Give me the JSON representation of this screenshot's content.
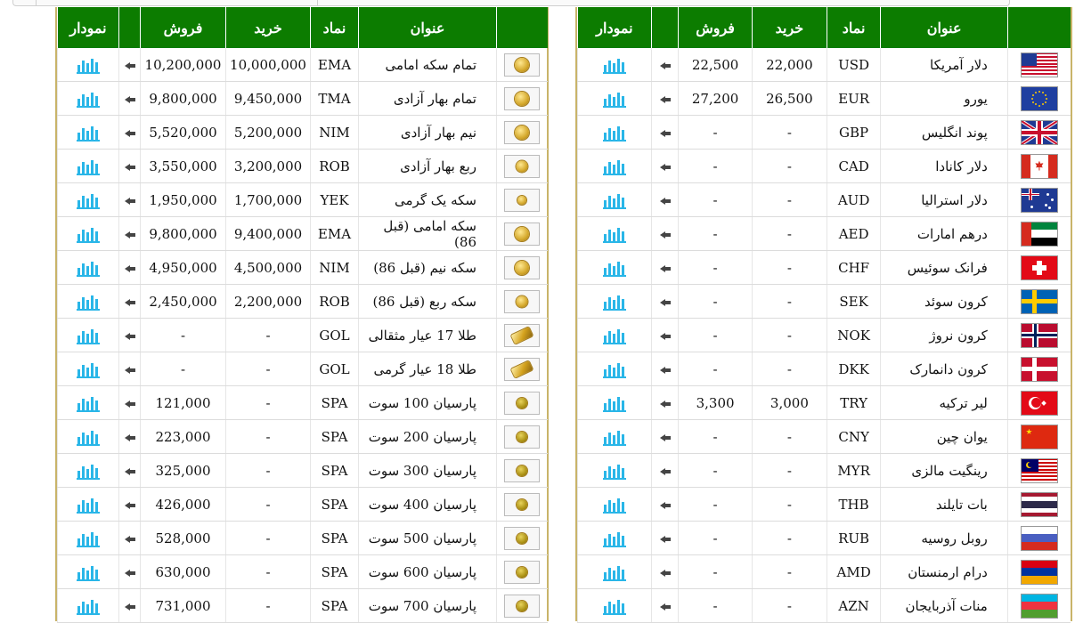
{
  "columns": {
    "chart": "نمودار",
    "sell": "فروش",
    "buy": "خرید",
    "symbol": "نماد",
    "title": "عنوان"
  },
  "coins": [
    {
      "title": "تمام سکه امامی",
      "symbol": "EMA",
      "buy": "10,000,000",
      "sell": "10,200,000",
      "icon": "gold-coin-icon",
      "size": "big"
    },
    {
      "title": "تمام بهار آزادی",
      "symbol": "TMA",
      "buy": "9,450,000",
      "sell": "9,800,000",
      "icon": "gold-coin-icon",
      "size": "big"
    },
    {
      "title": "نیم بهار آزادی",
      "symbol": "NIM",
      "buy": "5,200,000",
      "sell": "5,520,000",
      "icon": "gold-coin-icon",
      "size": "big"
    },
    {
      "title": "ربع بهار آزادی",
      "symbol": "ROB",
      "buy": "3,200,000",
      "sell": "3,550,000",
      "icon": "gold-coin-icon",
      "size": "mid"
    },
    {
      "title": "سکه یک گرمی",
      "symbol": "YEK",
      "buy": "1,700,000",
      "sell": "1,950,000",
      "icon": "gold-coin-icon",
      "size": "small"
    },
    {
      "title": "سکه امامی (قبل 86)",
      "symbol": "EMA",
      "buy": "9,400,000",
      "sell": "9,800,000",
      "icon": "gold-coin-icon",
      "size": "big"
    },
    {
      "title": "سکه نیم (قبل 86)",
      "symbol": "NIM",
      "buy": "4,500,000",
      "sell": "4,950,000",
      "icon": "gold-coin-icon",
      "size": "big"
    },
    {
      "title": "سکه ربع (قبل 86)",
      "symbol": "ROB",
      "buy": "2,200,000",
      "sell": "2,450,000",
      "icon": "gold-coin-icon",
      "size": "mid"
    },
    {
      "title": "طلا 17 عیار مثقالی",
      "symbol": "GOL",
      "buy": "-",
      "sell": "-",
      "icon": "gold-bar-icon",
      "size": "bullion"
    },
    {
      "title": "طلا 18 عیار گرمی",
      "symbol": "GOL",
      "buy": "-",
      "sell": "-",
      "icon": "gold-bar-icon",
      "size": "bullion"
    },
    {
      "title": "پارسیان 100 سوت",
      "symbol": "SPA",
      "buy": "-",
      "sell": "121,000",
      "icon": "parsian-coin-icon",
      "size": "parsian"
    },
    {
      "title": "پارسیان 200 سوت",
      "symbol": "SPA",
      "buy": "-",
      "sell": "223,000",
      "icon": "parsian-coin-icon",
      "size": "parsian"
    },
    {
      "title": "پارسیان 300 سوت",
      "symbol": "SPA",
      "buy": "-",
      "sell": "325,000",
      "icon": "parsian-coin-icon",
      "size": "parsian"
    },
    {
      "title": "پارسیان 400 سوت",
      "symbol": "SPA",
      "buy": "-",
      "sell": "426,000",
      "icon": "parsian-coin-icon",
      "size": "parsian"
    },
    {
      "title": "پارسیان 500 سوت",
      "symbol": "SPA",
      "buy": "-",
      "sell": "528,000",
      "icon": "parsian-coin-icon",
      "size": "parsian"
    },
    {
      "title": "پارسیان 600 سوت",
      "symbol": "SPA",
      "buy": "-",
      "sell": "630,000",
      "icon": "parsian-coin-icon",
      "size": "parsian"
    },
    {
      "title": "پارسیان 700 سوت",
      "symbol": "SPA",
      "buy": "-",
      "sell": "731,000",
      "icon": "parsian-coin-icon",
      "size": "parsian"
    }
  ],
  "currencies": [
    {
      "title": "دلار آمریکا",
      "symbol": "USD",
      "buy": "22,000",
      "sell": "22,500",
      "flag": "us"
    },
    {
      "title": "یورو",
      "symbol": "EUR",
      "buy": "26,500",
      "sell": "27,200",
      "flag": "eu"
    },
    {
      "title": "پوند انگلیس",
      "symbol": "GBP",
      "buy": "-",
      "sell": "-",
      "flag": "gb"
    },
    {
      "title": "دلار کانادا",
      "symbol": "CAD",
      "buy": "-",
      "sell": "-",
      "flag": "ca"
    },
    {
      "title": "دلار استرالیا",
      "symbol": "AUD",
      "buy": "-",
      "sell": "-",
      "flag": "au"
    },
    {
      "title": "درهم امارات",
      "symbol": "AED",
      "buy": "-",
      "sell": "-",
      "flag": "ae"
    },
    {
      "title": "فرانک سوئیس",
      "symbol": "CHF",
      "buy": "-",
      "sell": "-",
      "flag": "ch"
    },
    {
      "title": "کرون سوئد",
      "symbol": "SEK",
      "buy": "-",
      "sell": "-",
      "flag": "se"
    },
    {
      "title": "کرون نروژ",
      "symbol": "NOK",
      "buy": "-",
      "sell": "-",
      "flag": "no"
    },
    {
      "title": "کرون دانمارک",
      "symbol": "DKK",
      "buy": "-",
      "sell": "-",
      "flag": "dk"
    },
    {
      "title": "لیر ترکیه",
      "symbol": "TRY",
      "buy": "3,000",
      "sell": "3,300",
      "flag": "tr"
    },
    {
      "title": "یوان چین",
      "symbol": "CNY",
      "buy": "-",
      "sell": "-",
      "flag": "cn"
    },
    {
      "title": "رینگیت مالزی",
      "symbol": "MYR",
      "buy": "-",
      "sell": "-",
      "flag": "my"
    },
    {
      "title": "بات تایلند",
      "symbol": "THB",
      "buy": "-",
      "sell": "-",
      "flag": "th"
    },
    {
      "title": "روبل روسیه",
      "symbol": "RUB",
      "buy": "-",
      "sell": "-",
      "flag": "ru"
    },
    {
      "title": "درام ارمنستان",
      "symbol": "AMD",
      "buy": "-",
      "sell": "-",
      "flag": "am"
    },
    {
      "title": "منات آذربایجان",
      "symbol": "AZN",
      "buy": "-",
      "sell": "-",
      "flag": "az"
    }
  ],
  "colors": {
    "header_green": "#0c7c00",
    "panel_border": "#c9b469",
    "chart_icon": "#29b6e8"
  }
}
